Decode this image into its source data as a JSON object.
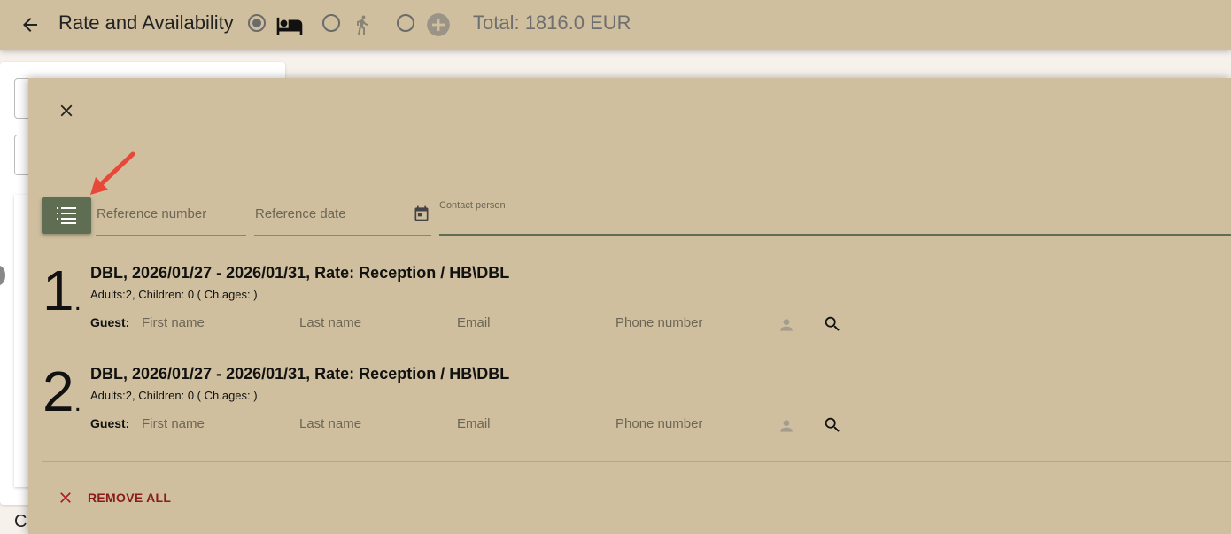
{
  "topbar": {
    "title": "Rate and Availability",
    "total": "Total: 1816.0 EUR",
    "modes": [
      {
        "icon": "bed-icon",
        "selected": true
      },
      {
        "icon": "walking-person-icon",
        "selected": false
      },
      {
        "icon": "plus-circle-icon",
        "selected": false
      }
    ]
  },
  "background": {
    "partial_text": "C"
  },
  "modal": {
    "reference_number_placeholder": "Reference number",
    "reference_date_placeholder": "Reference date",
    "contact_person_label": "Contact person",
    "rooms": [
      {
        "number": "1",
        "title": "DBL, 2026/01/27 - 2026/01/31, Rate: Reception / HB\\DBL",
        "occupancy": "Adults:2, Children: 0 ( Ch.ages: )",
        "guest_label": "Guest:",
        "first_name_placeholder": "First name",
        "last_name_placeholder": "Last name",
        "email_placeholder": "Email",
        "phone_placeholder": "Phone number"
      },
      {
        "number": "2",
        "title": "DBL, 2026/01/27 - 2026/01/31, Rate: Reception / HB\\DBL",
        "occupancy": "Adults:2, Children: 0 ( Ch.ages: )",
        "guest_label": "Guest:",
        "first_name_placeholder": "First name",
        "last_name_placeholder": "Last name",
        "email_placeholder": "Email",
        "phone_placeholder": "Phone number"
      }
    ],
    "remove_all_label": "REMOVE ALL"
  },
  "colors": {
    "header_bg": "#cfbf9e",
    "modal_bg": "#cfbf9e",
    "list_button_bg": "#5f6e52",
    "remove_color": "#8b1a1a",
    "annotation_arrow": "#e8483a"
  }
}
